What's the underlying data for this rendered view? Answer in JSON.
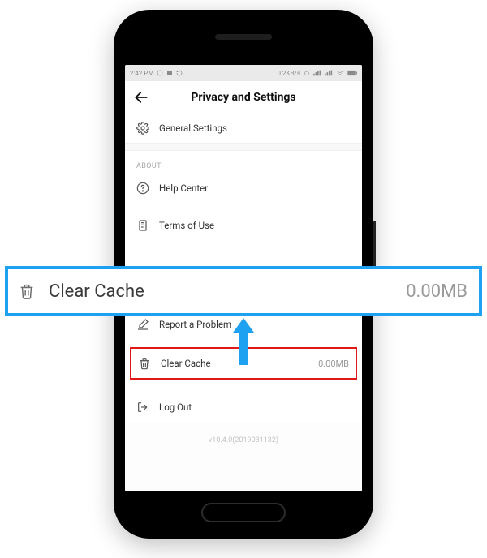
{
  "status": {
    "time": "2:42 PM",
    "net": "0.2KB/s"
  },
  "header": {
    "title": "Privacy and Settings"
  },
  "rows": {
    "general": "General Settings",
    "about_section": "ABOUT",
    "help": "Help Center",
    "terms": "Terms of Use",
    "report": "Report a Problem",
    "clear_cache": "Clear Cache",
    "clear_cache_value": "0.00MB",
    "logout": "Log Out"
  },
  "version": "v10.4.0(2019031132)",
  "callout": {
    "label": "Clear Cache",
    "value": "0.00MB"
  }
}
